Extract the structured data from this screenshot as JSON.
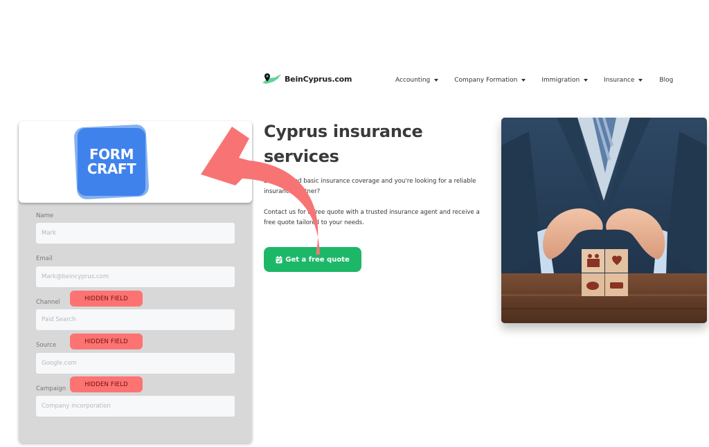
{
  "header": {
    "logo_text": "BeinCyprus.com",
    "nav": [
      {
        "label": "Accounting",
        "has_dropdown": true
      },
      {
        "label": "Company Formation",
        "has_dropdown": true
      },
      {
        "label": "Immigration",
        "has_dropdown": true
      },
      {
        "label": "Insurance",
        "has_dropdown": true
      },
      {
        "label": "Blog",
        "has_dropdown": false
      }
    ]
  },
  "hero": {
    "title": "Cyprus insurance services",
    "paragraph1": "Do you need basic insurance coverage and you're looking for a reliable insurance partner?",
    "paragraph2": "Contact us for a free quote with a trusted insurance agent and receive a free quote tailored to your needs.",
    "cta_label": "Get a free quote",
    "cta_icon": "calendar-check-icon",
    "image_alt": "Businessman's hands protecting wooden blocks with family, health, savings and car icons"
  },
  "form": {
    "logo_line1": "FORM",
    "logo_line2": "CRAFT",
    "fields": [
      {
        "label": "Name",
        "placeholder": "Mark",
        "hidden": false
      },
      {
        "label": "Email",
        "placeholder": "Mark@beincyprus.com",
        "hidden": false
      },
      {
        "label": "Channel",
        "placeholder": "Paid Search",
        "hidden": true
      },
      {
        "label": "Source",
        "placeholder": "Google.com",
        "hidden": true
      },
      {
        "label": "Campaign",
        "placeholder": "Company incorporation",
        "hidden": true
      }
    ],
    "hidden_badge_label": "HIDDEN FIELD"
  },
  "colors": {
    "cta_green": "#1db768",
    "formcraft_blue": "#3f82ec",
    "hidden_badge": "#fd7372",
    "arrow": "#f87474",
    "form_panel": "#d8d8d8"
  }
}
